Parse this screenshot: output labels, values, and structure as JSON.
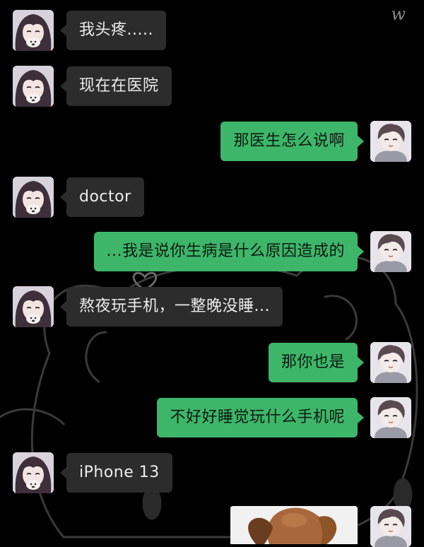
{
  "watermark": "w",
  "messages": [
    {
      "side": "left",
      "text": "我头疼....."
    },
    {
      "side": "left",
      "text": "现在在医院"
    },
    {
      "side": "right",
      "text": "那医生怎么说啊"
    },
    {
      "side": "left",
      "text": "doctor"
    },
    {
      "side": "right",
      "text": "...我是说你生病是什么原因造成的"
    },
    {
      "side": "left",
      "text": "熬夜玩手机，一整晚没睡..."
    },
    {
      "side": "right",
      "text": "那你也是"
    },
    {
      "side": "right",
      "text": "不好好睡觉玩什么手机呢"
    },
    {
      "side": "left",
      "text": "iPhone 13"
    },
    {
      "side": "right",
      "type": "image",
      "icon": "dog-photo"
    }
  ],
  "colors": {
    "background": "#000000",
    "incoming_bubble": "#2c2c2c",
    "outgoing_bubble": "#3db66a",
    "incoming_text": "#ececec",
    "outgoing_text": "#0d1a0f"
  },
  "icons": {
    "girl_avatar": "girl-avatar-icon",
    "boy_avatar": "boy-avatar-icon"
  }
}
